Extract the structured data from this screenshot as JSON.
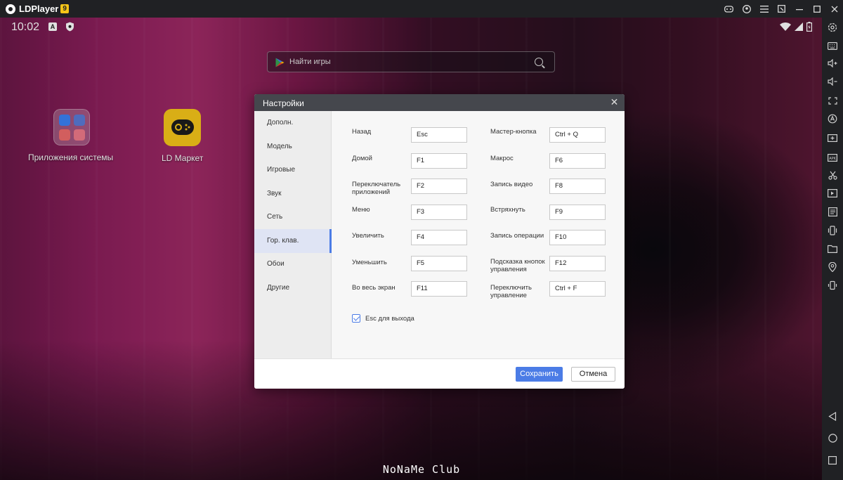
{
  "titlebar": {
    "app_name": "LDPlayer",
    "version_badge": "9",
    "icons": [
      "gamepad-icon",
      "account-icon",
      "menu-icon",
      "screenshot-icon",
      "minimize-icon",
      "maximize-icon",
      "close-icon"
    ]
  },
  "statusbar": {
    "time": "10:02",
    "notification_badge": "A"
  },
  "search": {
    "placeholder": "Найти игры"
  },
  "desktop": {
    "apps": [
      {
        "label": "Приложения системы"
      },
      {
        "label": "LD Маркет"
      }
    ]
  },
  "watermark": "NoNaMe Club",
  "dialog": {
    "title": "Настройки",
    "nav": [
      {
        "label": "Дополн."
      },
      {
        "label": "Модель"
      },
      {
        "label": "Игровые"
      },
      {
        "label": "Звук"
      },
      {
        "label": "Сеть"
      },
      {
        "label": "Гор. клав.",
        "active": true
      },
      {
        "label": "Обои"
      },
      {
        "label": "Другие"
      }
    ],
    "hotkeys_left": [
      {
        "label": "Назад",
        "key": "Esc"
      },
      {
        "label": "Домой",
        "key": "F1"
      },
      {
        "label": "Переключатель приложений",
        "key": "F2"
      },
      {
        "label": "Меню",
        "key": "F3"
      },
      {
        "label": "Увеличить",
        "key": "F4"
      },
      {
        "label": "Уменьшить",
        "key": "F5"
      },
      {
        "label": "Во весь экран",
        "key": "F11"
      }
    ],
    "hotkeys_right": [
      {
        "label": "Мастер-кнопка",
        "key": "Ctrl + Q"
      },
      {
        "label": "Макрос",
        "key": "F6"
      },
      {
        "label": "Запись видео",
        "key": "F8"
      },
      {
        "label": "Встряхнуть",
        "key": "F9"
      },
      {
        "label": "Запись операции",
        "key": "F10"
      },
      {
        "label": "Подсказка кнопок управления",
        "key": "F12"
      },
      {
        "label": "Переключить управление",
        "key": "Ctrl + F"
      }
    ],
    "esc_exit": {
      "label": "Esc для выхода",
      "checked": true
    },
    "save_label": "Сохранить",
    "cancel_label": "Отмена"
  },
  "right_sidebar": {
    "icons": [
      "settings-icon",
      "keyboard-icon",
      "volume-up-icon",
      "volume-down-icon",
      "fullscreen-icon",
      "sync-icon",
      "add-app-icon",
      "apk-icon",
      "scissors-icon",
      "record-icon",
      "operation-record-icon",
      "shake-icon",
      "folder-icon",
      "location-icon",
      "rotate-icon",
      "back-icon",
      "home-icon",
      "recent-apps-icon"
    ]
  },
  "colors": {
    "accent": "#4b7ce6",
    "titlebar": "#202124",
    "dialog_header": "#45474d"
  }
}
